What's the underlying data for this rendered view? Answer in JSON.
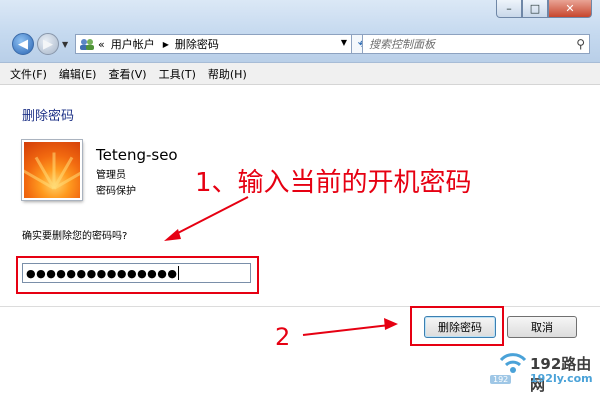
{
  "window": {
    "controls": [
      "–",
      "□",
      "✕"
    ]
  },
  "navigation": {
    "back_icon": "back-arrow-icon",
    "forward_icon": "forward-arrow-icon"
  },
  "address": {
    "overflow": "«",
    "crumbs": [
      "用户帐户",
      "删除密码"
    ]
  },
  "search": {
    "placeholder": "搜索控制面板"
  },
  "menu": [
    "文件(F)",
    "编辑(E)",
    "查看(V)",
    "工具(T)",
    "帮助(H)"
  ],
  "content": {
    "title": "删除密码",
    "user_name": "Teteng-seo",
    "user_role": "管理员",
    "user_protection": "密码保护",
    "confirm_text": "确实要删除您的密码吗?",
    "password_value": "●●●●●●●●●●●●●●●"
  },
  "buttons": {
    "delete_password": "删除密码",
    "cancel": "取消"
  },
  "annotations": {
    "step1": "1、输入当前的开机密码",
    "step2": "2",
    "color": "#e60012"
  },
  "watermark": {
    "brand": "192路由网",
    "site": "192ly.com",
    "ip": "192"
  }
}
